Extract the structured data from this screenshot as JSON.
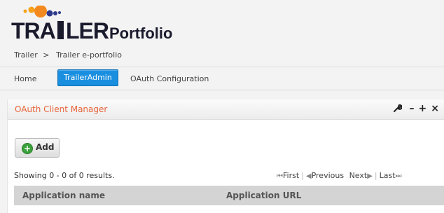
{
  "header": {
    "logo_text": "TRAILER",
    "portfolio_text": "Portfolio",
    "breadcrumb": {
      "item1": "Trailer",
      "separator": ">",
      "item2": "Trailer e-portfolio"
    }
  },
  "nav": {
    "items": [
      {
        "label": "Home"
      },
      {
        "label": "TrailerAdmin"
      },
      {
        "label": "OAuth Configuration"
      }
    ],
    "active_color": "#1a8fe0"
  },
  "panel": {
    "title": "OAuth Client Manager",
    "title_color": "#e8643a",
    "tools": {
      "wrench": "wrench-icon",
      "minimize": "–",
      "maximize": "+",
      "close": "×"
    }
  },
  "toolbar": {
    "add_label": "Add"
  },
  "results": {
    "summary": "Showing 0 - 0 of 0 results.",
    "pager": {
      "first": "First",
      "previous": "Previous",
      "next": "Next",
      "last": "Last"
    }
  },
  "table": {
    "columns": [
      "Application name",
      "Application URL"
    ]
  }
}
